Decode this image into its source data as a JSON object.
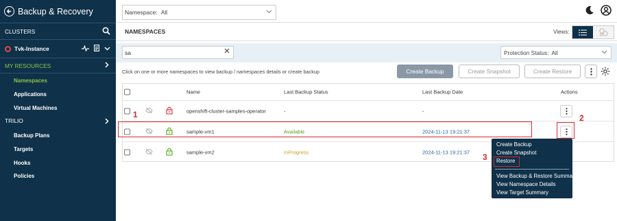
{
  "sidebar": {
    "title": "Backup & Recovery",
    "clusters_label": "CLUSTERS",
    "instance_name": "Tvk-Instance",
    "my_resources_label": "MY RESOURCES",
    "my_resources_items": [
      "Namespaces",
      "Applications",
      "Virtual Machines"
    ],
    "trilio_label": "TRILIO",
    "trilio_items": [
      "Backup Plans",
      "Targets",
      "Hooks",
      "Policies"
    ]
  },
  "topbar": {
    "namespace_label": "Namespace:",
    "namespace_value": "All"
  },
  "header": {
    "title": "NAMESPACES",
    "views_label": "Views:"
  },
  "search": {
    "value": "sa",
    "protection_label": "Protection Status:",
    "protection_value": "All"
  },
  "toolbar": {
    "hint": "Click on one or more namespaces to view backup / namespaces details or create backup",
    "create_backup": "Create Backup",
    "create_snapshot": "Create Snapshot",
    "create_restore": "Create Restore"
  },
  "table": {
    "columns": {
      "name": "Name",
      "status": "Last Backup Status",
      "date": "Last Backup Date",
      "actions": "Actions"
    },
    "rows": [
      {
        "name": "openshift-cluster-samples-operator",
        "status": "-",
        "date": "-",
        "status_color": "#333333",
        "lock_color": "#d8292f"
      },
      {
        "name": "sample-vm1",
        "status": "Available",
        "date": "2024-11-13 19:21:37",
        "status_color": "#5a9e1a",
        "lock_color": "#5a9e1a"
      },
      {
        "name": "sample-vm2",
        "status": "InProgress",
        "date": "2024-11-13 19:21:37",
        "status_color": "#c8a21e",
        "lock_color": "#5a9e1a"
      }
    ]
  },
  "menu": {
    "items": [
      "Create Backup",
      "Create Snapshot",
      "Restore"
    ],
    "items2": [
      "View Backup & Restore Summary",
      "View Namespace Details",
      "View Target Summary"
    ]
  },
  "annotations": {
    "step1": "1",
    "step2": "2",
    "step3": "3"
  },
  "colors": {
    "sidebar_bg": "#0f3149",
    "accent_green": "#8bc34a",
    "highlight_red": "#d8292f",
    "date_blue": "#1f5f9e"
  }
}
